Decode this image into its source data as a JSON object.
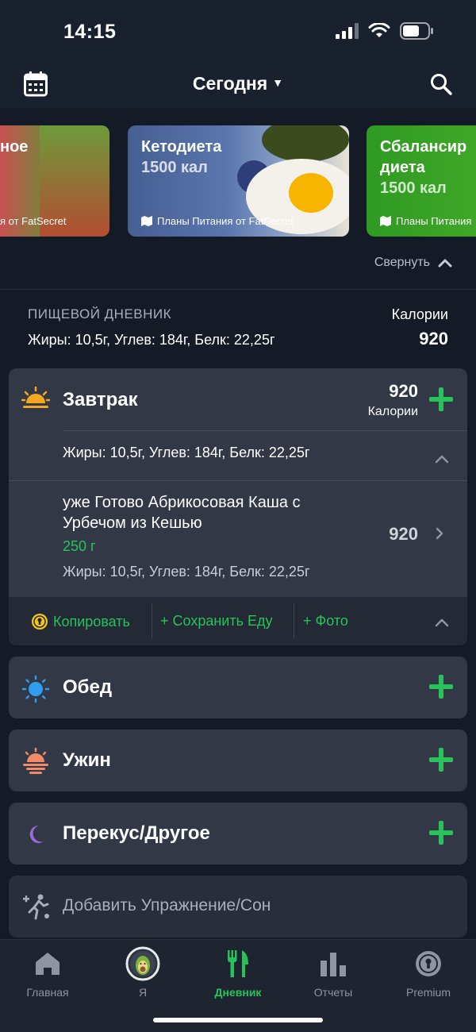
{
  "status_bar": {
    "time": "14:15"
  },
  "header": {
    "title": "Сегодня"
  },
  "banners": [
    {
      "title": "ное",
      "subtitle": "",
      "footer": "я от FatSecret"
    },
    {
      "title": "Кетодиета",
      "subtitle": "1500 кал",
      "footer": "Планы Питания от FatSecret"
    },
    {
      "title": "Сбалансир",
      "title2": "диета",
      "subtitle": "1500 кал",
      "footer": "Планы Питания"
    }
  ],
  "collapse_label": "Свернуть",
  "diary": {
    "label": "ПИЩЕВОЙ ДНЕВНИК",
    "macros": "Жиры: 10,5г, Углев: 184г, Белк: 22,25г",
    "calories_label": "Калории",
    "calories": "920"
  },
  "breakfast": {
    "name": "Завтрак",
    "calories": "920",
    "calories_label": "Калории",
    "macros": "Жиры: 10,5г, Углев: 184г, Белк: 22,25г",
    "food": {
      "name": "уже Готово Абрикосовая Каша с Урбечом из Кешью",
      "amount": "250 г",
      "macros": "Жиры: 10,5г, Углев: 184г, Белк: 22,25г",
      "calories": "920"
    },
    "actions": {
      "copy": "Копировать",
      "save": "+ Сохранить Еду",
      "photo": "+ Фото"
    }
  },
  "meals": {
    "lunch": "Обед",
    "dinner": "Ужин",
    "snack": "Перекус/Другое"
  },
  "exercise": {
    "label": "Добавить Упражнение/Сон"
  },
  "nav": [
    {
      "label": "Главная",
      "icon": "home-icon"
    },
    {
      "label": "Я",
      "icon": "avatar-icon"
    },
    {
      "label": "Дневник",
      "icon": "fork-knife-icon"
    },
    {
      "label": "Отчеты",
      "icon": "bar-chart-icon"
    },
    {
      "label": "Premium",
      "icon": "premium-badge-icon"
    }
  ],
  "colors": {
    "accent": "#27c35a",
    "background": "#151b26",
    "card": "#323846"
  }
}
